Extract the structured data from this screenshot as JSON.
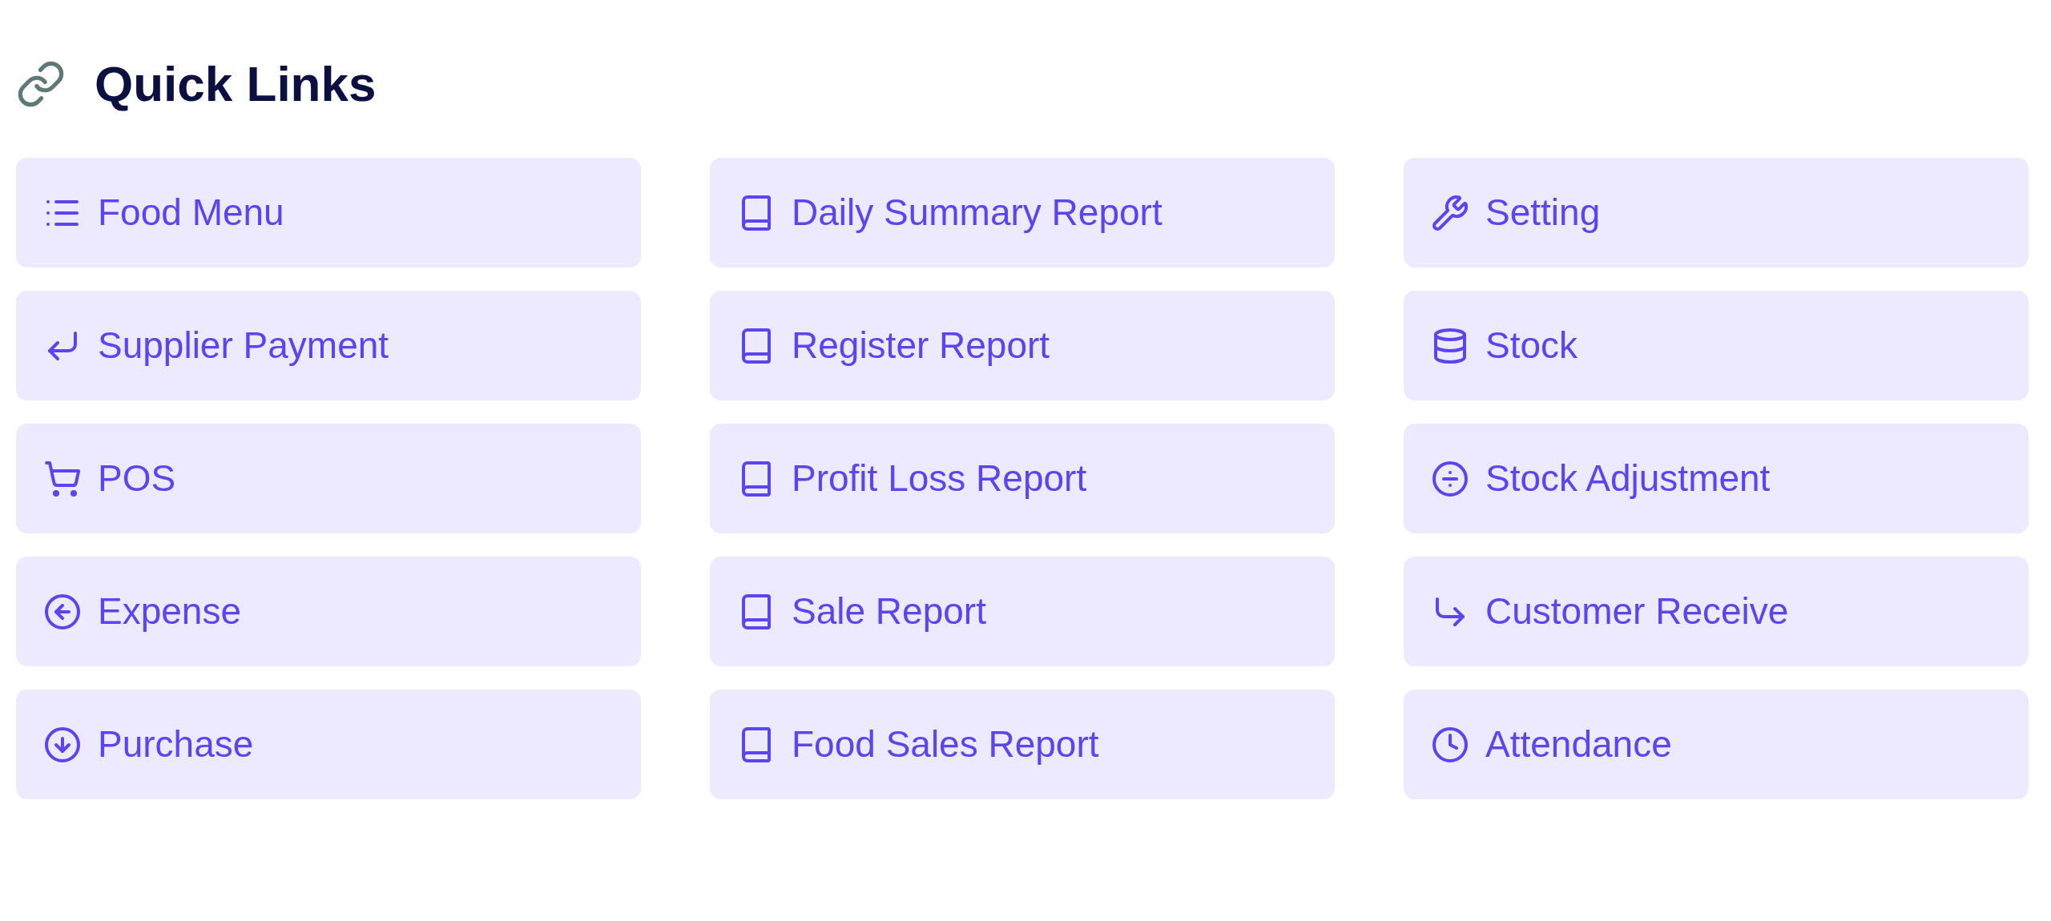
{
  "title": "Quick Links",
  "columns": [
    {
      "links": [
        "Food Menu",
        "Supplier Payment",
        "POS",
        "Expense",
        "Purchase"
      ]
    },
    {
      "links": [
        "Daily Summary Report",
        "Register Report",
        "Profit Loss Report",
        "Sale Report",
        "Food Sales Report"
      ]
    },
    {
      "links": [
        "Setting",
        "Stock",
        "Stock Adjustment",
        "Customer Receive",
        "Attendance"
      ]
    }
  ]
}
